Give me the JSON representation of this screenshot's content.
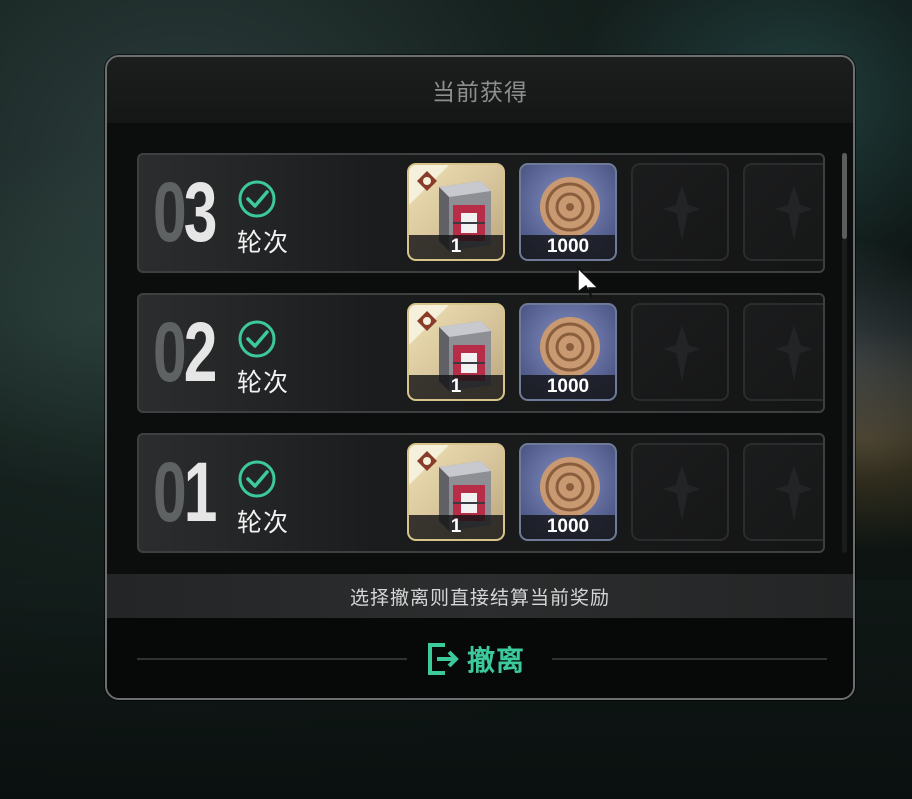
{
  "dialog": {
    "title": "当前获得",
    "info_text": "选择撤离则直接结算当前奖励",
    "withdraw_label": "撤离",
    "withdraw_icon": "exit-icon"
  },
  "rounds": [
    {
      "number_prefix": "0",
      "number_digit": "3",
      "label": "轮次",
      "status_icon": "check-circle-icon",
      "rewards": [
        {
          "icon": "chest-icon",
          "count": "1"
        },
        {
          "icon": "coin-icon",
          "count": "1000"
        }
      ],
      "empty_slots": 2
    },
    {
      "number_prefix": "0",
      "number_digit": "2",
      "label": "轮次",
      "status_icon": "check-circle-icon",
      "rewards": [
        {
          "icon": "chest-icon",
          "count": "1"
        },
        {
          "icon": "coin-icon",
          "count": "1000"
        }
      ],
      "empty_slots": 2
    },
    {
      "number_prefix": "0",
      "number_digit": "1",
      "label": "轮次",
      "status_icon": "check-circle-icon",
      "rewards": [
        {
          "icon": "chest-icon",
          "count": "1"
        },
        {
          "icon": "coin-icon",
          "count": "1000"
        }
      ],
      "empty_slots": 2
    }
  ],
  "colors": {
    "accent": "#3cc99c",
    "chest_frame": "#d8c48a",
    "coin_frame": "#6f7b98"
  }
}
